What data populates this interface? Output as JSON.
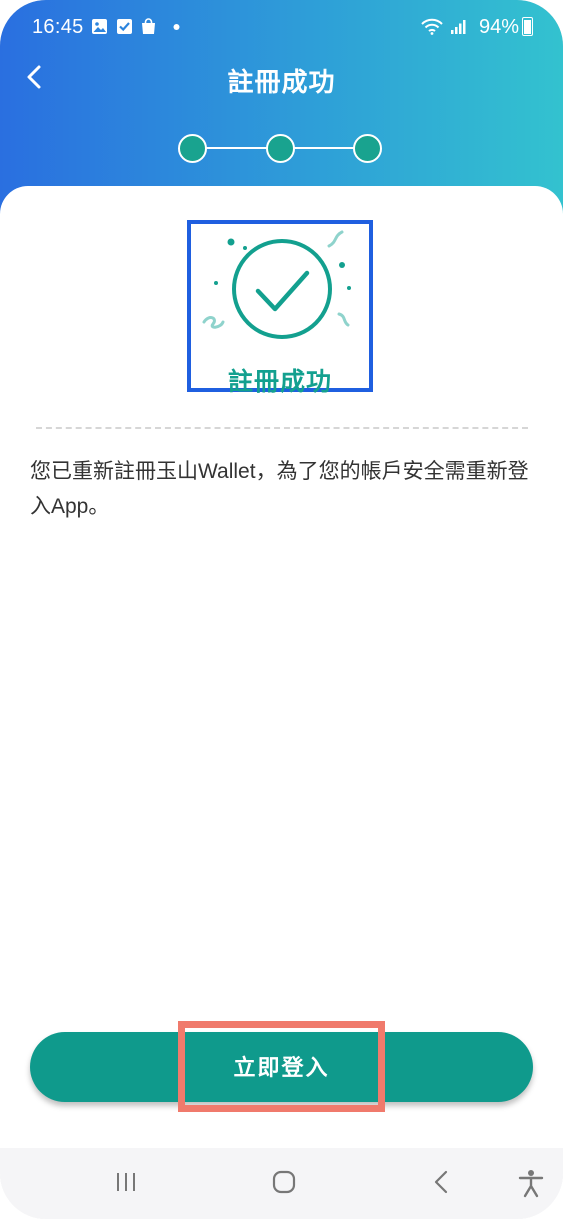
{
  "status_bar": {
    "time": "16:45",
    "battery": "94%",
    "notification_icons": [
      "gallery-icon",
      "checkbox-icon",
      "shopping-bag-icon",
      "dot-icon"
    ],
    "system_icons": [
      "wifi-icon",
      "signal-icon",
      "battery-icon"
    ]
  },
  "header": {
    "title": "註冊成功",
    "back_icon": "chevron-left-icon",
    "steps_total": 3,
    "steps_completed": 3
  },
  "illustration": {
    "icon": "check-circle-icon",
    "label": "註冊成功"
  },
  "message": "您已重新註冊玉山Wallet，為了您的帳戶安全需重新登入App。",
  "primary_button": {
    "label": "立即登入"
  },
  "nav_bar": {
    "items": [
      "recent-apps-icon",
      "home-icon",
      "back-icon",
      "accessibility-icon"
    ]
  },
  "colors": {
    "header_gradient_start": "#2a6fe0",
    "header_gradient_end": "#33c2cf",
    "accent_teal": "#0f9a8c",
    "highlight_box": "#1f5fe0",
    "annotation_box": "#f07a6c"
  }
}
